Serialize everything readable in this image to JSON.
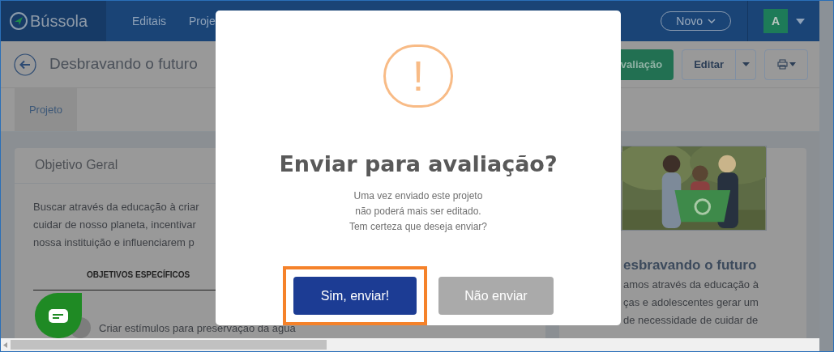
{
  "nav": {
    "logo": "Bússola",
    "items": [
      "Editais",
      "Proje"
    ],
    "new_button": "Novo",
    "avatar": "A"
  },
  "header": {
    "title": "Desbravando o futuro",
    "submit_button": "valiação",
    "edit_button": "Editar"
  },
  "tabs": [
    {
      "label": "Projeto",
      "selected": true
    }
  ],
  "objective_card": {
    "title": "Objetivo Geral",
    "lines": [
      "Buscar através da educação à criar",
      "cuidar de nosso planeta, incentivar",
      "nossa instituição e influenciarem p"
    ],
    "specific_heading": "OBJETIVOS ESPECÍFICOS",
    "specific_items": [
      "Criar estímulos para preservação da água"
    ]
  },
  "project_card": {
    "title": "esbravando o futuro",
    "lines": [
      "amos através da educação à",
      "ças e adolescentes gerar um",
      "de necessidade de cuidar de"
    ]
  },
  "dialog": {
    "icon": "!",
    "title": "Enviar para avaliação?",
    "message_lines": [
      "Uma vez enviado este projeto",
      "não poderá mais ser editado.",
      "Tem certeza que deseja enviar?"
    ],
    "confirm_button": "Sim, enviar!",
    "cancel_button": "Não enviar",
    "confirm_highlighted": true
  }
}
